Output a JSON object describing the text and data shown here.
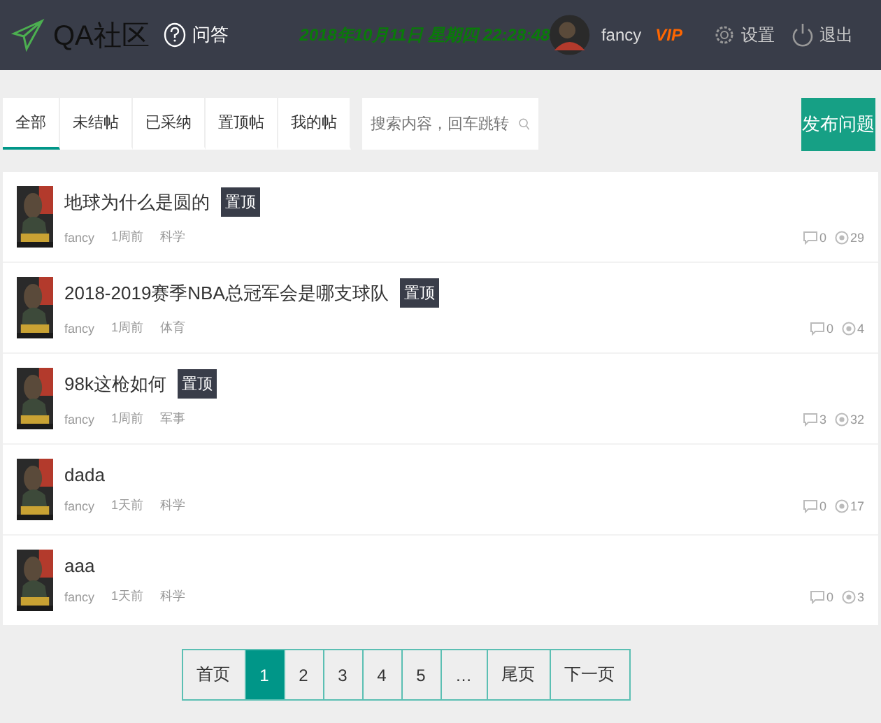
{
  "header": {
    "logo": "QA社区",
    "nav": "问答",
    "datetime": "2018年10月11日 星期四  22:28:48",
    "user": {
      "name": "fancy",
      "badge": "VIP"
    },
    "settings": "设置",
    "logout": "退出"
  },
  "tabs": [
    {
      "label": "全部",
      "selected": true
    },
    {
      "label": "未结帖",
      "selected": false
    },
    {
      "label": "已采纳",
      "selected": false
    },
    {
      "label": "置顶帖",
      "selected": false
    },
    {
      "label": "我的帖",
      "selected": false
    }
  ],
  "search": {
    "placeholder": "搜索内容，回车跳转"
  },
  "post_button": "发布问题",
  "posts": [
    {
      "title": "地球为什么是圆的",
      "pinned": true,
      "pin_label": "置顶",
      "author": "fancy",
      "time": "1周前",
      "category": "科学",
      "comments": "0",
      "views": "29"
    },
    {
      "title": "2018-2019赛季NBA总冠军会是哪支球队",
      "pinned": true,
      "pin_label": "置顶",
      "author": "fancy",
      "time": "1周前",
      "category": "体育",
      "comments": "0",
      "views": "4"
    },
    {
      "title": "98k这枪如何",
      "pinned": true,
      "pin_label": "置顶",
      "author": "fancy",
      "time": "1周前",
      "category": "军事",
      "comments": "3",
      "views": "32"
    },
    {
      "title": "dada",
      "pinned": false,
      "author": "fancy",
      "time": "1天前",
      "category": "科学",
      "comments": "0",
      "views": "17"
    },
    {
      "title": "aaa",
      "pinned": false,
      "author": "fancy",
      "time": "1天前",
      "category": "科学",
      "comments": "0",
      "views": "3"
    }
  ],
  "pagination": [
    {
      "label": "首页",
      "selected": false
    },
    {
      "label": "1",
      "selected": true
    },
    {
      "label": "2",
      "selected": false
    },
    {
      "label": "3",
      "selected": false
    },
    {
      "label": "4",
      "selected": false
    },
    {
      "label": "5",
      "selected": false
    },
    {
      "label": "…",
      "selected": false
    },
    {
      "label": "尾页",
      "selected": false
    },
    {
      "label": "下一页",
      "selected": false
    }
  ]
}
